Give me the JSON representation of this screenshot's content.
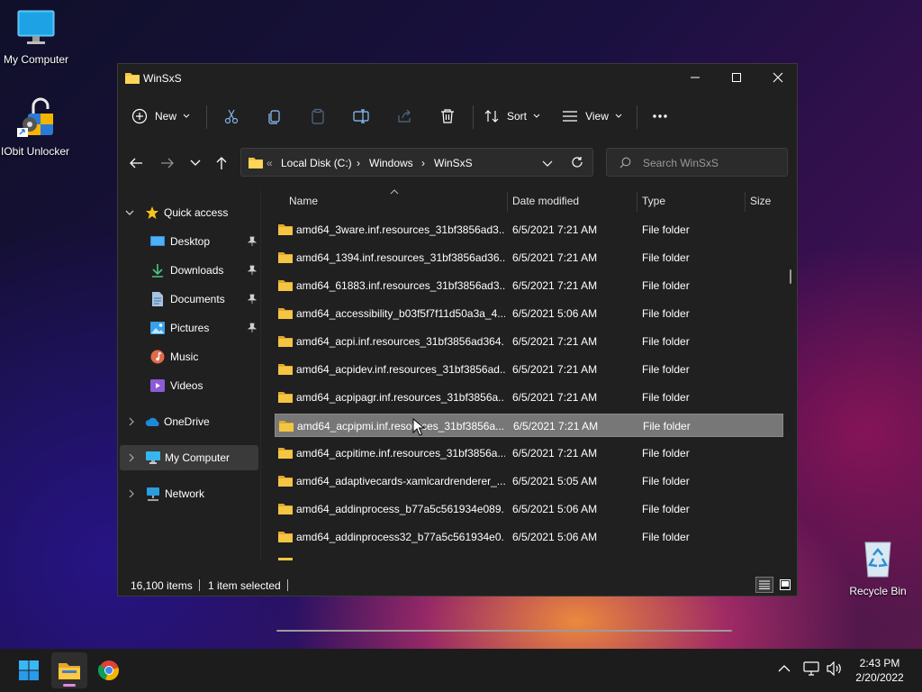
{
  "desktop": {
    "icons": [
      {
        "label": "My Computer"
      },
      {
        "label": "IObit Unlocker"
      },
      {
        "label": "Recycle Bin"
      }
    ]
  },
  "window": {
    "title": "WinSxS",
    "toolbar": {
      "new_label": "New",
      "sort_label": "Sort",
      "view_label": "View"
    },
    "address": {
      "overflow": "«",
      "crumbs": [
        "Local Disk (C:)",
        "Windows",
        "WinSxS"
      ],
      "separator": "›"
    },
    "search": {
      "placeholder": "Search WinSxS"
    },
    "nav": {
      "quick_access": "Quick access",
      "items": [
        {
          "label": "Desktop",
          "icon": "desktop-icon",
          "pinned": true
        },
        {
          "label": "Downloads",
          "icon": "download-icon",
          "pinned": true
        },
        {
          "label": "Documents",
          "icon": "document-icon",
          "pinned": true
        },
        {
          "label": "Pictures",
          "icon": "pictures-icon",
          "pinned": true
        },
        {
          "label": "Music",
          "icon": "music-icon",
          "pinned": false
        },
        {
          "label": "Videos",
          "icon": "videos-icon",
          "pinned": false
        }
      ],
      "onedrive": "OneDrive",
      "my_computer": "My Computer",
      "network": "Network"
    },
    "columns": {
      "name": "Name",
      "date": "Date modified",
      "type": "Type",
      "size": "Size"
    },
    "rows": [
      {
        "name": "amd64_3ware.inf.resources_31bf3856ad3...",
        "date": "6/5/2021 7:21 AM",
        "type": "File folder"
      },
      {
        "name": "amd64_1394.inf.resources_31bf3856ad36...",
        "date": "6/5/2021 7:21 AM",
        "type": "File folder"
      },
      {
        "name": "amd64_61883.inf.resources_31bf3856ad3...",
        "date": "6/5/2021 7:21 AM",
        "type": "File folder"
      },
      {
        "name": "amd64_accessibility_b03f5f7f11d50a3a_4....",
        "date": "6/5/2021 5:06 AM",
        "type": "File folder"
      },
      {
        "name": "amd64_acpi.inf.resources_31bf3856ad364...",
        "date": "6/5/2021 7:21 AM",
        "type": "File folder"
      },
      {
        "name": "amd64_acpidev.inf.resources_31bf3856ad...",
        "date": "6/5/2021 7:21 AM",
        "type": "File folder"
      },
      {
        "name": "amd64_acpipagr.inf.resources_31bf3856a...",
        "date": "6/5/2021 7:21 AM",
        "type": "File folder"
      },
      {
        "name": "amd64_acpipmi.inf.resources_31bf3856a...",
        "date": "6/5/2021 7:21 AM",
        "type": "File folder"
      },
      {
        "name": "amd64_acpitime.inf.resources_31bf3856a...",
        "date": "6/5/2021 7:21 AM",
        "type": "File folder"
      },
      {
        "name": "amd64_adaptivecards-xamlcardrenderer_...",
        "date": "6/5/2021 5:05 AM",
        "type": "File folder"
      },
      {
        "name": "amd64_addinprocess_b77a5c561934e089....",
        "date": "6/5/2021 5:06 AM",
        "type": "File folder"
      },
      {
        "name": "amd64_addinprocess32_b77a5c561934e0...",
        "date": "6/5/2021 5:06 AM",
        "type": "File folder"
      }
    ],
    "selected_row_index": 7,
    "status": {
      "item_count": "16,100 items",
      "selection": "1 item selected"
    }
  },
  "taskbar": {
    "time": "2:43 PM",
    "date": "2/20/2022",
    "apps": [
      "start-icon",
      "file-explorer-icon",
      "chrome-icon"
    ]
  },
  "colors": {
    "window_bg": "#202020",
    "selected_row": "#777777",
    "folder_yellow": "#f4c542",
    "accent_blue": "#4aa3ff"
  }
}
